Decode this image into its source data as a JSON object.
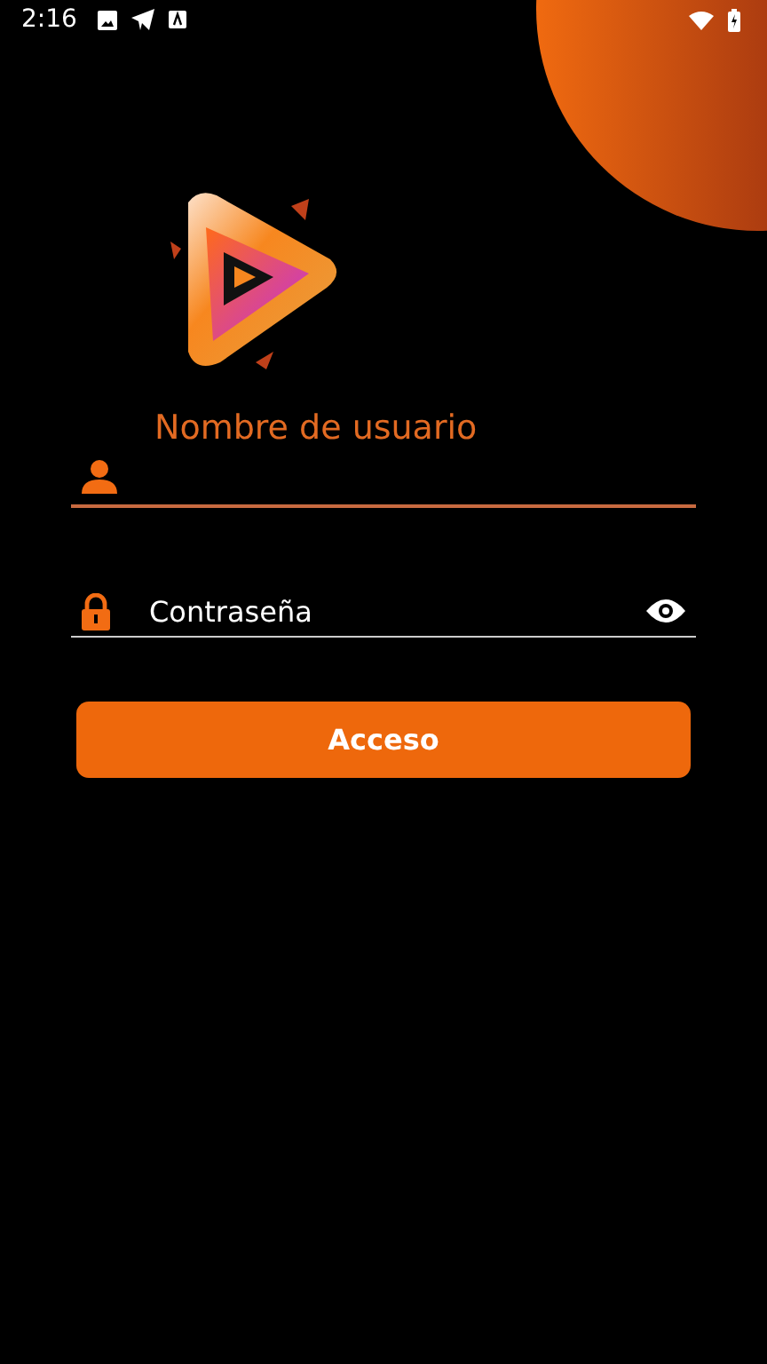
{
  "status_bar": {
    "time": "2:16"
  },
  "username": {
    "label": "Nombre de usuario",
    "focused": true
  },
  "password": {
    "placeholder": "Contraseña",
    "focused": false
  },
  "login_button": {
    "label": "Acceso"
  }
}
